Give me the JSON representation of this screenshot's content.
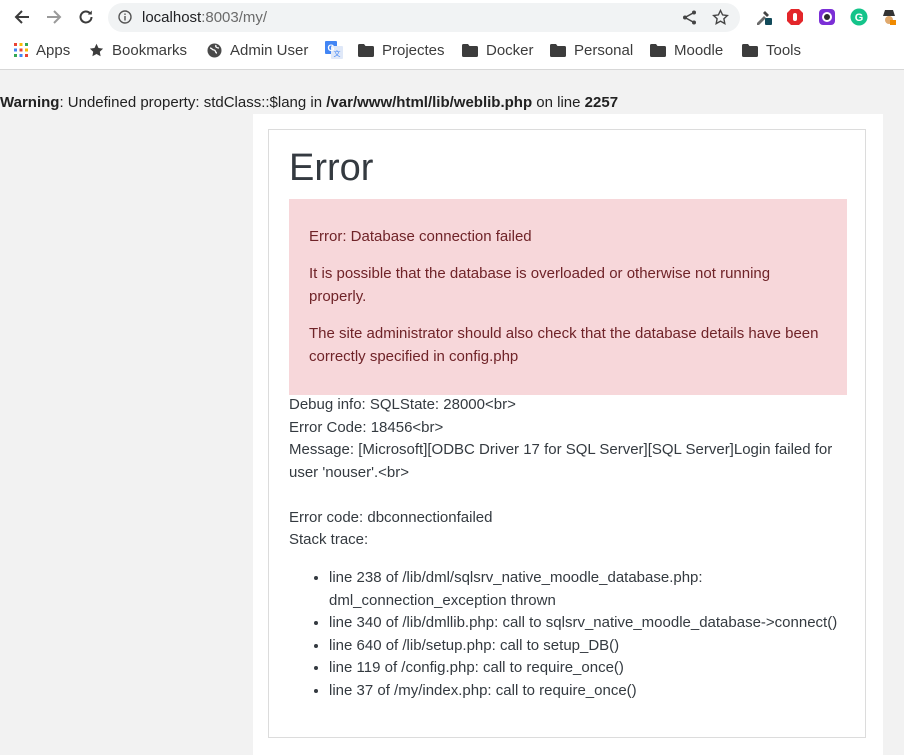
{
  "browser": {
    "url_host": "localhost",
    "url_rest": ":8003/my/",
    "bookmarks": [
      {
        "label": "Apps",
        "icon": "apps-grid-icon"
      },
      {
        "label": "Bookmarks",
        "icon": "star-icon"
      },
      {
        "label": "Admin User",
        "icon": "globe-icon"
      },
      {
        "label": "",
        "icon": "translate-icon"
      },
      {
        "label": "Projectes",
        "icon": "folder-icon"
      },
      {
        "label": "Docker",
        "icon": "folder-icon"
      },
      {
        "label": "Personal",
        "icon": "folder-icon"
      },
      {
        "label": "Moodle",
        "icon": "folder-icon"
      },
      {
        "label": "Tools",
        "icon": "folder-icon"
      }
    ]
  },
  "warning": {
    "label": "Warning",
    "text1": ": Undefined property: stdClass::$lang in ",
    "path": "/var/www/html/lib/weblib.php",
    "text2": " on line ",
    "line": "2257"
  },
  "error": {
    "title": "Error",
    "alert": [
      "Error: Database connection failed",
      "It is possible that the database is overloaded or otherwise not running properly.",
      "The site administrator should also check that the database details have been correctly specified in config.php"
    ],
    "debug_lines": [
      "Debug info: SQLState: 28000<br>",
      "Error Code: 18456<br>",
      "Message: [Microsoft][ODBC Driver 17 for SQL Server][SQL Server]Login failed for user 'nouser'.<br>"
    ],
    "error_code": "Error code: dbconnectionfailed",
    "stack_label": "Stack trace:",
    "stack": [
      "line 238 of /lib/dml/sqlsrv_native_moodle_database.php: dml_connection_exception thrown",
      "line 340 of /lib/dmllib.php: call to sqlsrv_native_moodle_database->connect()",
      "line 640 of /lib/setup.php: call to setup_DB()",
      "line 119 of /config.php: call to require_once()",
      "line 37 of /my/index.php: call to require_once()"
    ]
  },
  "colors": {
    "alert_bg": "#f7d7da",
    "alert_text": "#6f2328",
    "body_text": "#343a40"
  }
}
